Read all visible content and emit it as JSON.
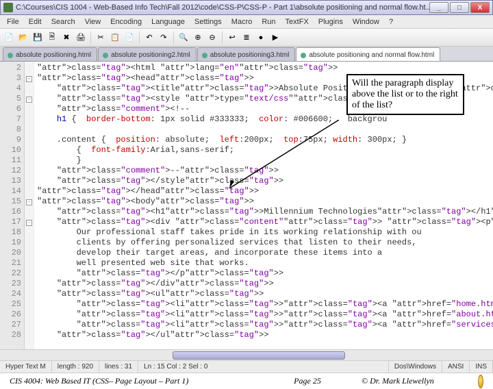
{
  "titlebar": {
    "path": "C:\\Courses\\CIS 1004 - Web-Based Info Tech\\Fall 2012\\code\\CSS-P\\CSS-P - Part 1\\absolute positioning and normal flow.ht..."
  },
  "win": {
    "min": "_",
    "max": "□",
    "close": "X"
  },
  "menu": [
    "File",
    "Edit",
    "Search",
    "View",
    "Encoding",
    "Language",
    "Settings",
    "Macro",
    "Run",
    "TextFX",
    "Plugins",
    "Window",
    "?"
  ],
  "tabs": [
    {
      "label": "absolute positioning.html",
      "active": false
    },
    {
      "label": "absolute positioning2.html",
      "active": false
    },
    {
      "label": "absolute positioning3.html",
      "active": false
    },
    {
      "label": "absolute positioning and normal flow.html",
      "active": true
    }
  ],
  "gutter_lines": [
    "2",
    "3",
    "4",
    "5",
    "6",
    "7",
    "8",
    "9",
    "10",
    "11",
    "12",
    "13",
    "14",
    "15",
    "16",
    "17",
    "18",
    "19",
    "20",
    "21",
    "22",
    "23",
    "24",
    "25",
    "26",
    "27",
    "28"
  ],
  "folds": {
    "3": "-",
    "5": "-",
    "15": "-",
    "17": "-"
  },
  "code": {
    "l2": "<html lang=\"en\">",
    "l3": "<head>",
    "l4": "    <title>Absolute Positioning and Normal Flow</title>",
    "l5": "    <style type=\"text/css\">",
    "l6": "    <!--",
    "l7": "    h1 {  border-bottom: 1px solid #333333;  color: #006600;   backgrou",
    "l8": "",
    "l9": "    .content {  position: absolute;  left:200px;  top:75px; width: 300px; }",
    "l10": "        {  font-family:Arial,sans-serif;",
    "l11": "        }",
    "l12": "    -->",
    "l13": "    </style>",
    "l14": "</head>",
    "l15": "<body>",
    "l16": "    <h1>Millennium Technologies</h1>",
    "l17": "    <div class=\"content\"> <p>",
    "l18": "        Our professional staff takes pride in its working relationship with ou",
    "l19": "        clients by offering personalized services that listen to their needs,",
    "l20": "        develop their target areas, and incorporate these items into a",
    "l21": "        well presented web site that works.",
    "l22": "        </p>",
    "l23": "    </div>",
    "l24": "    <ul>",
    "l25": "        <li><a href=\"home.html\">Home</a></li>",
    "l26": "        <li><a href=\"about.html\">About</a></li>",
    "l27": "        <li><a href=\"services.html\">Services</a></li>",
    "l28": "    </ul>"
  },
  "callout": "Will the paragraph display above the list or to the right of the list?",
  "status": {
    "lang": "Hyper Text M",
    "length": "length : 920",
    "lines": "lines : 31",
    "pos": "Ln : 15   Col : 2   Sel : 0",
    "eol": "Dos\\Windows",
    "enc": "ANSI",
    "mode": "INS"
  },
  "footer": {
    "left": "CIS 4004: Web Based IT (CSS– Page Layout – Part 1)",
    "page": "Page 25",
    "right": "© Dr. Mark Llewellyn"
  },
  "icons": {
    "new": "📄",
    "open": "📂",
    "save": "💾",
    "saveall": "🗎",
    "close": "✖",
    "print": "🖨",
    "cut": "✂",
    "copy": "📋",
    "paste": "📄",
    "undo": "↶",
    "redo": "↷",
    "find": "🔍",
    "zoom_in": "⊕",
    "zoom_out": "⊖",
    "wrap": "↩",
    "list": "≣",
    "rec": "●",
    "play": "▶"
  }
}
